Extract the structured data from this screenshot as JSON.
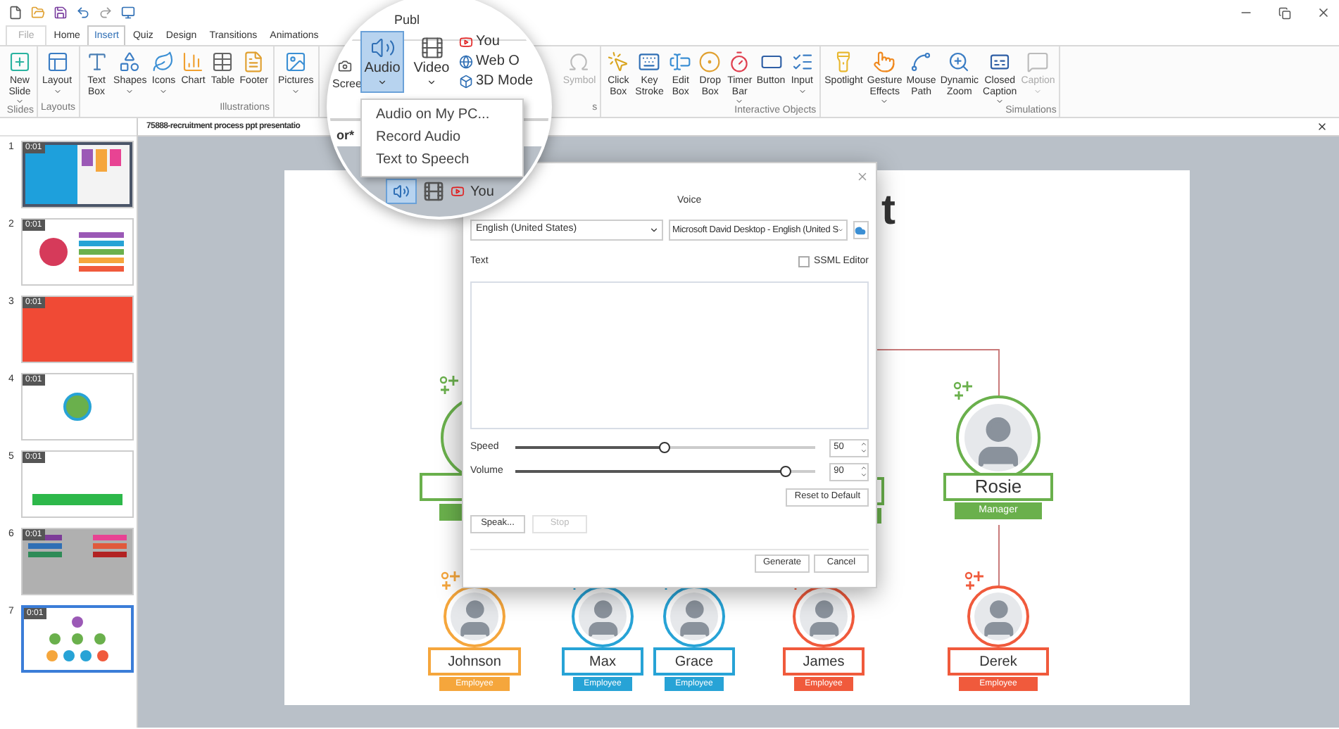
{
  "tabs": [
    {
      "label": "File",
      "kind": "backstage",
      "selected": false
    },
    {
      "label": "Home",
      "kind": "tab",
      "selected": false
    },
    {
      "label": "Insert",
      "kind": "tab",
      "selected": true
    },
    {
      "label": "Quiz",
      "kind": "tab",
      "selected": false
    },
    {
      "label": "Design",
      "kind": "tab",
      "selected": false
    },
    {
      "label": "Transitions",
      "kind": "tab",
      "selected": false
    },
    {
      "label": "Animations",
      "kind": "tab",
      "selected": false
    }
  ],
  "ribbon": {
    "groups": [
      {
        "label": "Slides",
        "items": [
          {
            "label": "New\nSlide",
            "dropdown": true,
            "disabled": false
          }
        ]
      },
      {
        "label": "Layouts",
        "items": [
          {
            "label": "Layout",
            "dropdown": true,
            "disabled": false
          }
        ]
      },
      {
        "label": "Illustrations",
        "items": [
          {
            "label": "Text\nBox",
            "dropdown": false,
            "disabled": false
          },
          {
            "label": "Shapes",
            "dropdown": true,
            "disabled": false
          },
          {
            "label": "Icons",
            "dropdown": true,
            "disabled": false
          },
          {
            "label": "Chart",
            "dropdown": false,
            "disabled": false
          },
          {
            "label": "Table",
            "dropdown": false,
            "disabled": false
          },
          {
            "label": "Footer",
            "dropdown": false,
            "disabled": false
          }
        ]
      },
      {
        "items": [
          {
            "label": "Pictures",
            "dropdown": true,
            "disabled": false
          }
        ]
      },
      {
        "label": "s",
        "items": [
          {
            "label": "Symbol",
            "dropdown": false,
            "disabled": true
          }
        ]
      },
      {
        "label": "Interactive Objects",
        "items": [
          {
            "label": "Click\nBox",
            "dropdown": false,
            "disabled": false
          },
          {
            "label": "Key\nStroke",
            "dropdown": false,
            "disabled": false
          },
          {
            "label": "Edit\nBox",
            "dropdown": false,
            "disabled": false
          },
          {
            "label": "Drop\nBox",
            "dropdown": false,
            "disabled": false
          },
          {
            "label": "Timer\nBar",
            "dropdown": true,
            "disabled": false
          },
          {
            "label": "Button",
            "dropdown": false,
            "disabled": false
          },
          {
            "label": "Input",
            "dropdown": true,
            "disabled": false
          }
        ]
      },
      {
        "label": "Simulations",
        "items": [
          {
            "label": "Spotlight",
            "dropdown": false,
            "disabled": false
          },
          {
            "label": "Gesture\nEffects",
            "dropdown": true,
            "disabled": false
          },
          {
            "label": "Mouse\nPath",
            "dropdown": false,
            "disabled": false
          },
          {
            "label": "Dynamic\nZoom",
            "dropdown": false,
            "disabled": false
          },
          {
            "label": "Closed\nCaption",
            "dropdown": true,
            "disabled": false
          },
          {
            "label": "Caption",
            "dropdown": true,
            "disabled": true
          }
        ]
      }
    ]
  },
  "magnifier": {
    "tab": "Publ",
    "left_label": "Scree",
    "buttons": [
      {
        "label": "Audio",
        "selected": true
      },
      {
        "label": "Video",
        "selected": false
      }
    ],
    "links": [
      "You",
      "Web O",
      "3D Mode"
    ],
    "menu": [
      "Audio on My PC...",
      "Record Audio",
      "Text to Speech"
    ],
    "doc_tab_fragment": "or*",
    "lower_link": "You"
  },
  "document_tab": {
    "title": "75888-recruitment process ppt presentatio"
  },
  "slides": [
    {
      "number": "1",
      "time": "0:01",
      "selected": false
    },
    {
      "number": "2",
      "time": "0:01",
      "selected": false
    },
    {
      "number": "3",
      "time": "0:01",
      "selected": false
    },
    {
      "number": "4",
      "time": "0:01",
      "selected": false
    },
    {
      "number": "5",
      "time": "0:01",
      "selected": false
    },
    {
      "number": "6",
      "time": "0:01",
      "selected": false
    },
    {
      "number": "7",
      "time": "0:01",
      "selected": true
    }
  ],
  "slide": {
    "title_fragment": "t",
    "people": [
      {
        "name": "Rosie",
        "role": "Manager",
        "color": "#6ab04c"
      },
      {
        "name": "Johnson",
        "role": "Employee",
        "color": "#f5a63c"
      },
      {
        "name": "Max",
        "role": "Employee",
        "color": "#27a3d6"
      },
      {
        "name": "Grace",
        "role": "Employee",
        "color": "#27a3d6"
      },
      {
        "name": "James",
        "role": "Employee",
        "color": "#f05a3c"
      },
      {
        "name": "Derek",
        "role": "Employee",
        "color": "#f05a3c"
      }
    ]
  },
  "dialog": {
    "voice_label": "Voice",
    "language": "English (United States)",
    "voice": "Microsoft David Desktop - English (United S",
    "text_label": "Text",
    "ssml": {
      "label": "SSML Editor",
      "checked": false
    },
    "sliders": [
      {
        "label": "Speed",
        "level": 0.5,
        "value": "50"
      },
      {
        "label": "Volume",
        "level": 0.9,
        "value": "90"
      }
    ],
    "reset": "Reset to Default",
    "actions": [
      {
        "label": "Speak...",
        "disabled": false
      },
      {
        "label": "Stop",
        "disabled": true
      }
    ],
    "footer": [
      "Generate",
      "Cancel"
    ]
  }
}
